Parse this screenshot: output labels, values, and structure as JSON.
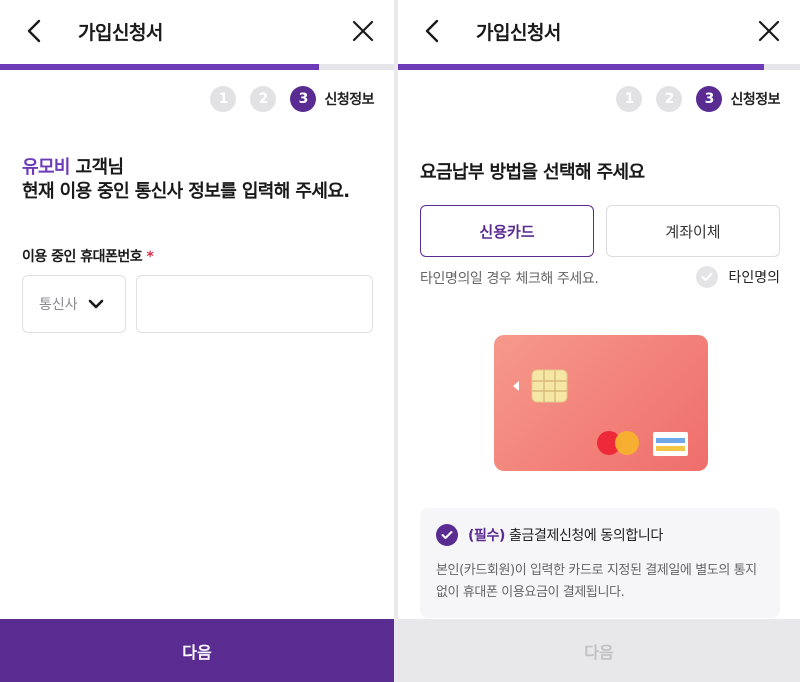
{
  "left": {
    "header": {
      "title": "가입신청서"
    },
    "progress": 0.8,
    "steps": {
      "s1": "1",
      "s2": "2",
      "s3": "3",
      "current_label": "신청정보"
    },
    "greeting": {
      "name": "유모비",
      "suffix": " 고객님",
      "line2": "현재 이용 중인 통신사 정보를 입력해 주세요."
    },
    "phone_field": {
      "label": "이용 중인 휴대폰번호",
      "required_mark": "*",
      "carrier_placeholder": "통신사",
      "number_value": ""
    },
    "next_button": "다음"
  },
  "right": {
    "header": {
      "title": "가입신청서"
    },
    "progress": 0.96,
    "steps": {
      "s1": "1",
      "s2": "2",
      "s3": "3",
      "current_label": "신청정보"
    },
    "section_title": "요금납부 방법을 선택해 주세요",
    "payment_tabs": [
      {
        "label": "신용카드",
        "selected": true
      },
      {
        "label": "계좌이체",
        "selected": false
      }
    ],
    "other_name_hint": "타인명의일 경우 체크해 주세요.",
    "other_name_check": {
      "label": "타인명의",
      "checked": false
    },
    "agreement": {
      "required": "(필수)",
      "text": " 출금결제신청에 동의합니다",
      "desc": "본인(카드회원)이 입력한 카드로 지정된 결제일에 별도의 통지 없이 휴대폰 이용요금이 결제됩니다.",
      "checked": true
    },
    "next_button": "다음"
  },
  "colors": {
    "accent": "#5a2b91",
    "accent_light": "#6e3bb8",
    "required": "#d6304a",
    "card": "#ef6e6c",
    "disabled": "#e8e8ea"
  },
  "icons": [
    "back-arrow-icon",
    "close-icon",
    "chevron-down-icon",
    "check-icon",
    "card-chip-icon",
    "card-brand-icon"
  ]
}
